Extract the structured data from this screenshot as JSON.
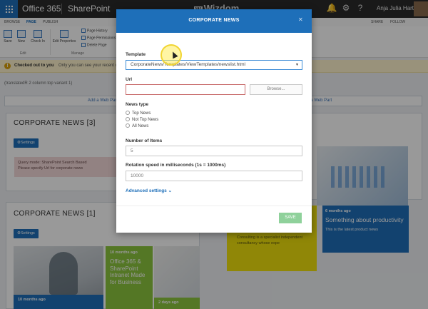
{
  "suite": {
    "app_launcher": "app-launcher",
    "office": "Office 365",
    "sharepoint": "SharePoint",
    "brand": "Wizdom",
    "icons": [
      "bell-icon",
      "gear-icon",
      "help-icon"
    ],
    "user": "Anja Julia Hartzell"
  },
  "ribbon": {
    "tabs": [
      "BROWSE",
      "PAGE",
      "PUBLISH"
    ],
    "buttons": [
      "Save",
      "New",
      "Check In",
      "Edit Properties"
    ],
    "small": [
      "Page History",
      "Page Permissions",
      "Delete Page"
    ],
    "groups": [
      "Edit",
      "Manage"
    ],
    "right": [
      "SHARE",
      "FOLLOW"
    ]
  },
  "checkout": {
    "bold": "Checked out to you",
    "text": "Only you can see your recent changes"
  },
  "layout_label": "(translatedR 2 column top variant 1)",
  "add_webpart_left": "Add a Web Part",
  "add_webpart_right": "Add a Web Part",
  "panels": {
    "top_title": "CORPORATE NEWS [3]",
    "top_settings": "Settings",
    "top_message": "Query mode: SharePoint Search Based\nPlease specify Url for corporate news",
    "bottom_title": "CORPORATE NEWS [1]",
    "bottom_settings": "Settings"
  },
  "tiles": {
    "t1_when": "10 months ago",
    "t2_when": "10 months ago",
    "t2_title": "Office 365 & SharePoint Intranet Made for Business",
    "t3_when": "2 days ago",
    "t4_text": "Manuel J. Stockgan Solution Catalina Consulting is a specialist independent consultancy whose expe",
    "t5_when": "6 months ago",
    "t5_title": "Something about productivity",
    "t5_sub": "This is the latest product news"
  },
  "modal": {
    "title": "CORPORATE NEWS",
    "template_label": "Template",
    "template_value": "CorporateNews/Templates/ViewTemplates/newslist.html",
    "url_label": "Url",
    "url_value": "",
    "browse": "Browse...",
    "news_type_label": "News type",
    "news_types": [
      "Top News",
      "Not Top News",
      "All News"
    ],
    "items_label": "Number of Items",
    "items_value": "5",
    "speed_label": "Rotation speed in milliseconds (1s = 1000ms)",
    "speed_value": "10000",
    "advanced": "Advanced settings",
    "save": "SAVE"
  }
}
